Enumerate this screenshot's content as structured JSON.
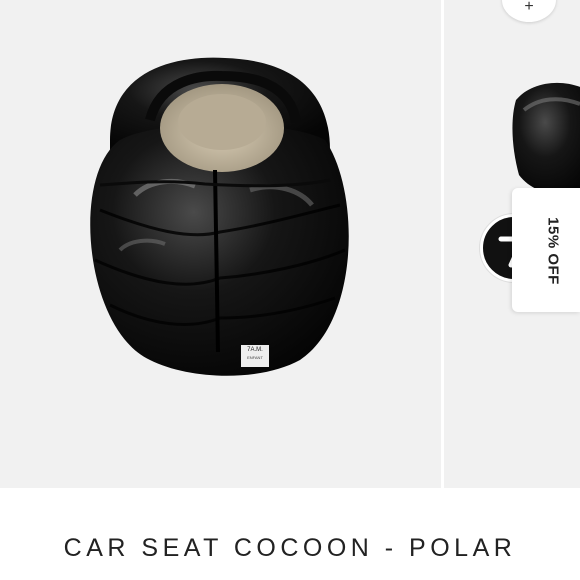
{
  "product": {
    "title": "CAR SEAT COCOON - POLAR",
    "label_brand": "7A.M.",
    "label_sub": "ENFANT"
  },
  "promo": {
    "badge": "15% OFF"
  },
  "gallery": {
    "zoom_icon": "plus-icon",
    "background": "#f1f1f1"
  }
}
